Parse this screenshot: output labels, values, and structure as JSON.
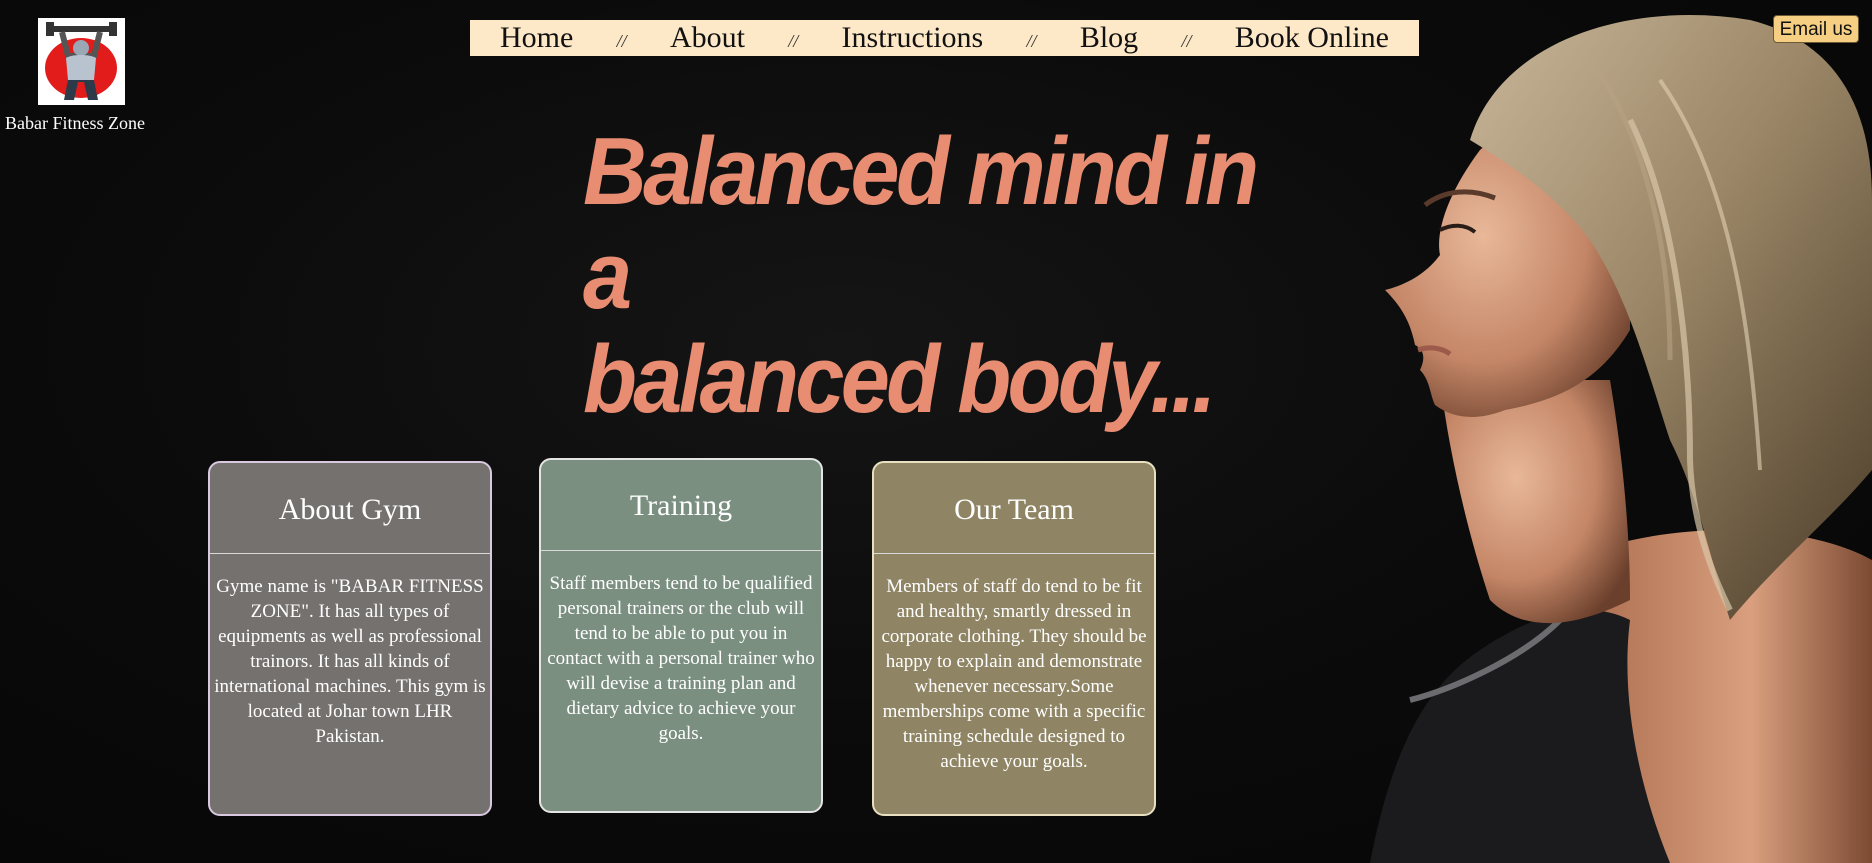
{
  "brand": {
    "name": "Babar Fitness Zone",
    "logo_icon": "weightlifter-logo-icon"
  },
  "nav": {
    "items": [
      {
        "label": "Home"
      },
      {
        "label": "About"
      },
      {
        "label": "Instructions"
      },
      {
        "label": "Blog"
      },
      {
        "label": "Book Online"
      }
    ],
    "separator": "//"
  },
  "email_button": {
    "label": "Email us"
  },
  "hero": {
    "headline_line1": "Balanced mind in a",
    "headline_line2": "balanced body..."
  },
  "cards": [
    {
      "title": "About Gym",
      "body": "Gyme name is \"BABAR FITNESS ZONE\". It has all types of equipments as well as professional trainors. It has all kinds of international machines. This gym is located at Johar town LHR Pakistan."
    },
    {
      "title": "Training",
      "body": "Staff members tend to be qualified personal trainers or the club will tend to be able to put you in contact with a personal trainer who will devise a training plan and dietary advice to achieve your goals."
    },
    {
      "title": "Our Team",
      "body": "Members of staff do tend to be fit and healthy, smartly dressed in corporate clothing. They should be happy to explain and demonstrate whenever necessary.Some memberships come with a specific training schedule designed to achieve your goals."
    }
  ],
  "colors": {
    "headline": "#e88c72",
    "nav_background": "#fde8c8",
    "email_button": "#f7cf82",
    "card_about": "#75716f",
    "card_training": "#7a8f80",
    "card_team": "#8f8464"
  }
}
